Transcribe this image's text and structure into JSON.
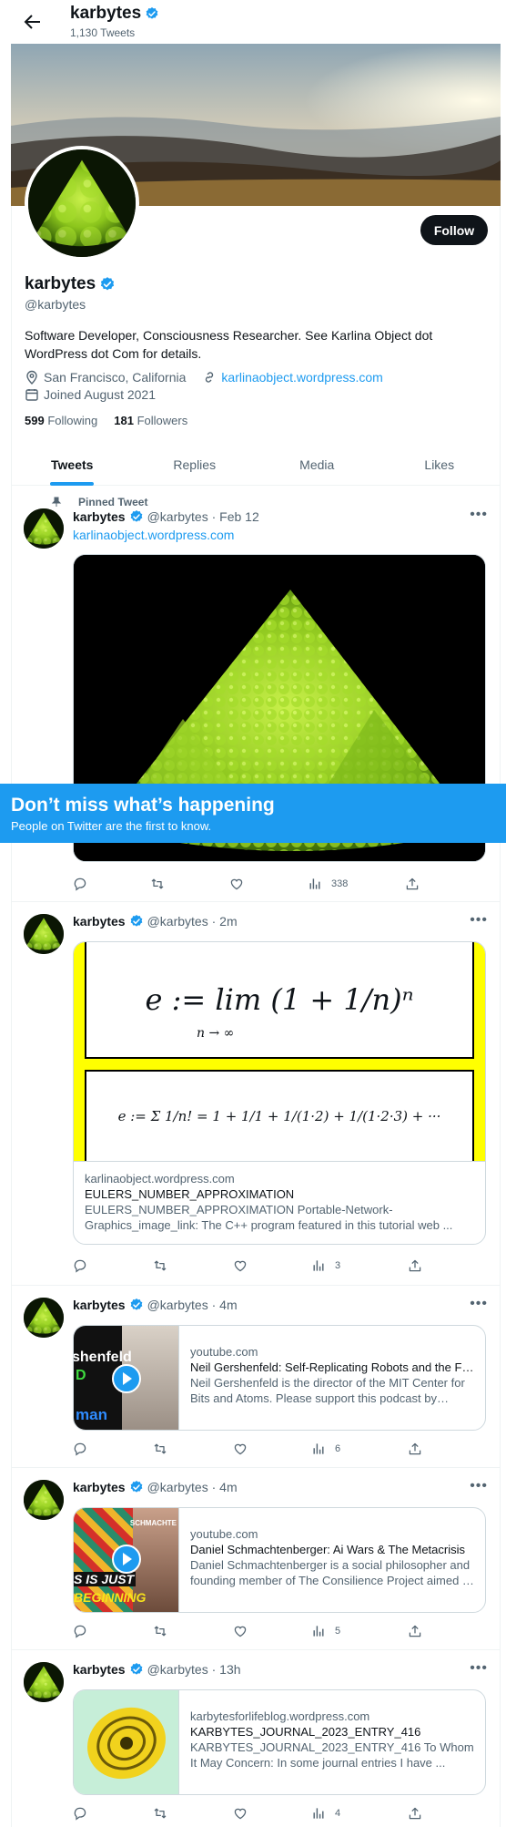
{
  "header": {
    "name": "karbytes",
    "tweet_count": "1,130 Tweets"
  },
  "profile": {
    "follow_label": "Follow",
    "name": "karbytes",
    "handle": "@karbytes",
    "bio": "Software Developer, Consciousness Researcher. See Karlina Object dot WordPress dot Com for details.",
    "location": "San Francisco, California",
    "website": "karlinaobject.wordpress.com",
    "joined": "Joined August 2021",
    "following_count": "599",
    "following_label": "Following",
    "followers_count": "181",
    "followers_label": "Followers"
  },
  "tabs": [
    "Tweets",
    "Replies",
    "Media",
    "Likes"
  ],
  "tweets": [
    {
      "pinned_label": "Pinned Tweet",
      "name": "karbytes",
      "meta": "@karbytes · Feb 12",
      "text": "karlinaobject.wordpress.com",
      "views": "338"
    },
    {
      "name": "karbytes",
      "meta": "@karbytes · 2m",
      "card_domain": "karlinaobject.wordpress.com",
      "card_title": "EULERS_NUMBER_APPROXIMATION",
      "card_desc": "EULERS_NUMBER_APPROXIMATION Portable-Network-Graphics_image_link: The C++ program featured in this tutorial web ...",
      "views": "3"
    },
    {
      "name": "karbytes",
      "meta": "@karbytes · 4m",
      "card_domain": "youtube.com",
      "card_title": "Neil Gershenfeld: Self-Replicating Robots and the Future of Fabrication",
      "card_desc": "Neil Gershenfeld is the director of the MIT Center for Bits and Atoms. Please support this podcast by checking out our sponsors",
      "thumb_text_1": "shenfeld",
      "thumb_text_2": "D",
      "thumb_text_3": "man",
      "views": "6"
    },
    {
      "name": "karbytes",
      "meta": "@karbytes · 4m",
      "card_domain": "youtube.com",
      "card_title": "Daniel Schmachtenberger: Ai Wars & The Metacrisis",
      "card_desc": "Daniel Schmachtenberger is a social philosopher and founding member of The Consilience Project aimed at improving public sensemaking",
      "thumb_text_1": "SCHMACHTE",
      "thumb_text_2": "S IS JUST",
      "thumb_text_3": "BEGINNING",
      "views": "5"
    },
    {
      "name": "karbytes",
      "meta": "@karbytes · 13h",
      "card_domain": "karbytesforlifeblog.wordpress.com",
      "card_title": "KARBYTES_JOURNAL_2023_ENTRY_416",
      "card_desc": "KARBYTES_JOURNAL_2023_ENTRY_416 To Whom It May Concern: In some journal entries I have ...",
      "views": "4"
    }
  ],
  "math": {
    "line1": "e := lim (1 + 1/n)ⁿ",
    "lim_sub": "n → ∞",
    "line2": "e := Σ 1/n! = 1 + 1/1 + 1/(1·2) + 1/(1·2·3) + ···"
  },
  "toast": {
    "title": "Don’t miss what’s happening",
    "subtitle": "People on Twitter are the first to know."
  },
  "colors": {
    "accent": "#1d9bf0",
    "text": "#0f1419",
    "muted": "#536471"
  }
}
